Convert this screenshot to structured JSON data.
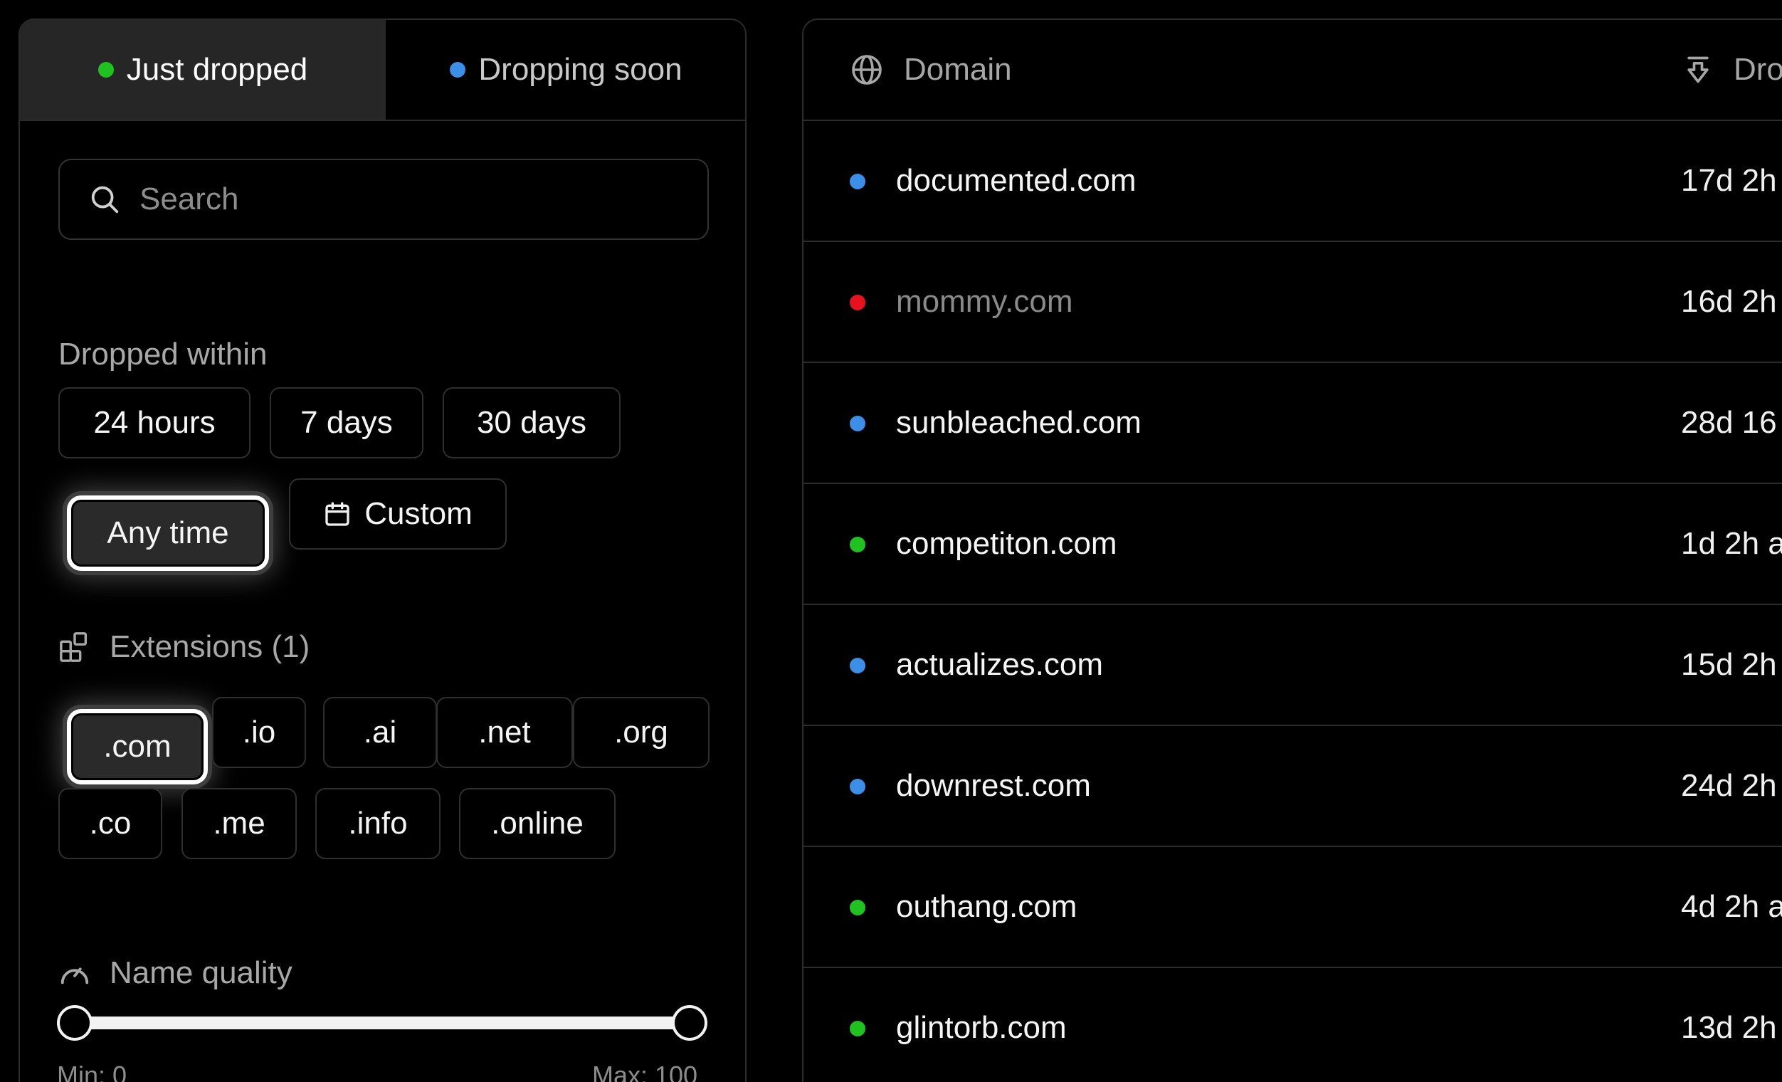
{
  "tabs": [
    {
      "label": "Just dropped",
      "dot_color": "#1fc21f",
      "active": true
    },
    {
      "label": "Dropping soon",
      "dot_color": "#3b8fe6",
      "active": false
    }
  ],
  "search": {
    "placeholder": "Search",
    "value": ""
  },
  "dropped_within": {
    "label": "Dropped within",
    "options": [
      "24 hours",
      "7 days",
      "30 days",
      "Any time",
      "Custom"
    ],
    "selected": "Any time"
  },
  "extensions": {
    "label": "Extensions (1)",
    "options": [
      ".com",
      ".io",
      ".ai",
      ".net",
      ".org",
      ".co",
      ".me",
      ".info",
      ".online"
    ],
    "selected": [
      ".com"
    ]
  },
  "name_quality": {
    "label": "Name quality",
    "min_label": "Min: 0",
    "max_label": "Max: 100",
    "min_value": 0,
    "max_value": 100
  },
  "table": {
    "columns": [
      "Domain",
      "Dro"
    ],
    "rows": [
      {
        "domain": "documented.com",
        "status": "blue",
        "time": "17d 2h"
      },
      {
        "domain": "mommy.com",
        "status": "red",
        "time": "16d 2h"
      },
      {
        "domain": "sunbleached.com",
        "status": "blue",
        "time": "28d 16"
      },
      {
        "domain": "competiton.com",
        "status": "green",
        "time": "1d 2h a"
      },
      {
        "domain": "actualizes.com",
        "status": "blue",
        "time": "15d 2h"
      },
      {
        "domain": "downrest.com",
        "status": "blue",
        "time": "24d 2h"
      },
      {
        "domain": "outhang.com",
        "status": "green",
        "time": "4d 2h a"
      },
      {
        "domain": "glintorb.com",
        "status": "green",
        "time": "13d 2h"
      }
    ]
  },
  "colors": {
    "green": "#1fc21f",
    "blue": "#3b8fe6",
    "red": "#e8121e",
    "background": "#000000",
    "border": "#2b2b2b"
  }
}
